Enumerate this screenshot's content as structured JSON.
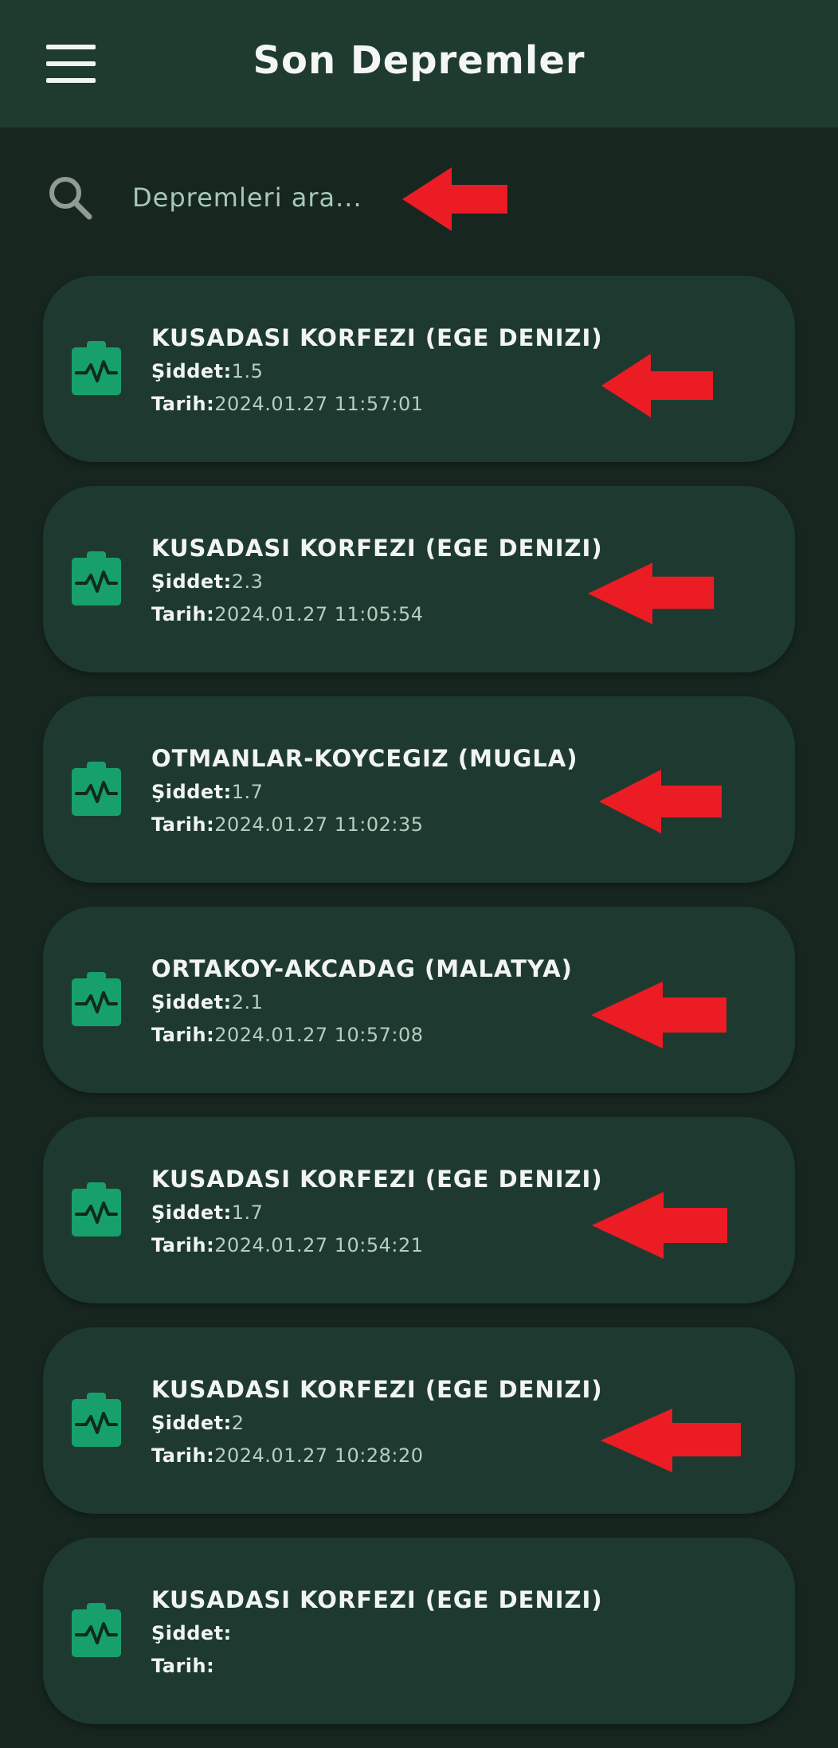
{
  "app_bar": {
    "title": "Son Depremler"
  },
  "search": {
    "placeholder": "Depremleri ara..."
  },
  "labels": {
    "magnitude": "Şiddet:",
    "date": "Tarih:"
  },
  "earthquakes": [
    {
      "location": "KUSADASI KORFEZI (EGE DENIZI)",
      "magnitude": "1.5",
      "date": "2024.01.27 11:57:01"
    },
    {
      "location": "KUSADASI KORFEZI (EGE DENIZI)",
      "magnitude": "2.3",
      "date": "2024.01.27 11:05:54"
    },
    {
      "location": "OTMANLAR-KOYCEGIZ (MUGLA)",
      "magnitude": "1.7",
      "date": "2024.01.27 11:02:35"
    },
    {
      "location": "ORTAKOY-AKCADAG (MALATYA)",
      "magnitude": "2.1",
      "date": "2024.01.27 10:57:08"
    },
    {
      "location": "KUSADASI KORFEZI (EGE DENIZI)",
      "magnitude": "1.7",
      "date": "2024.01.27 10:54:21"
    },
    {
      "location": "KUSADASI KORFEZI (EGE DENIZI)",
      "magnitude": "2",
      "date": "2024.01.27 10:28:20"
    },
    {
      "location": "KUSADASI KORFEZI (EGE DENIZI)",
      "magnitude": "",
      "date": ""
    }
  ],
  "colors": {
    "app_bar": "#1f3a2e",
    "background": "#172720",
    "card": "#1e3a30",
    "accent_icon": "#17a06c",
    "annotation_arrow": "#ec1c24"
  },
  "icons": {
    "menu": "hamburger-menu-icon",
    "search": "search-icon",
    "card": "clipboard-pulse-icon",
    "annotation": "red-arrow-left"
  }
}
